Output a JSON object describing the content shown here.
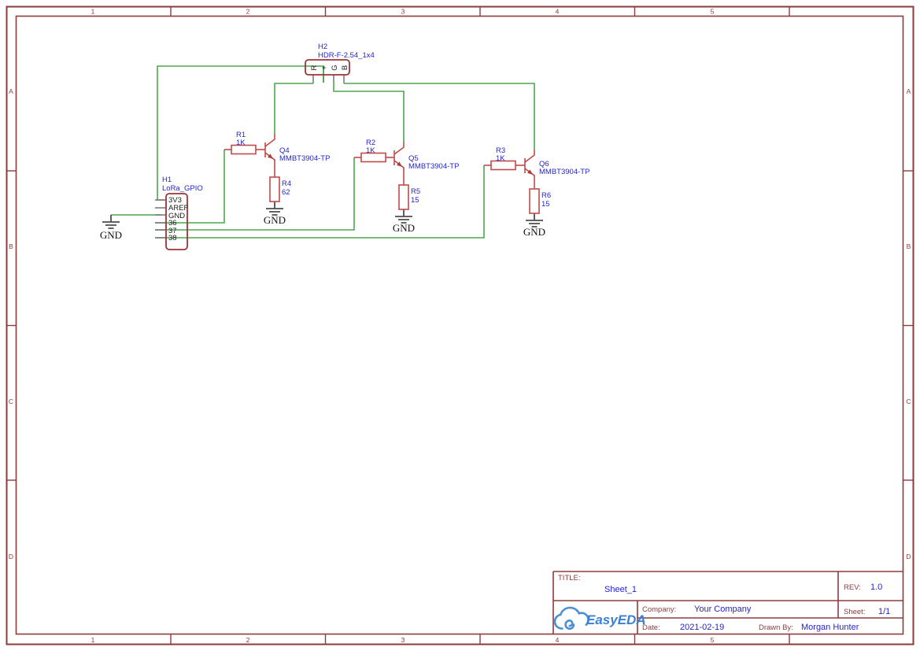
{
  "sheet": {
    "cols": [
      "1",
      "2",
      "3",
      "4",
      "5"
    ],
    "rows": [
      "A",
      "B",
      "C",
      "D"
    ]
  },
  "title_block": {
    "title_label": "TITLE:",
    "title": "Sheet_1",
    "rev_label": "REV:",
    "rev": "1.0",
    "company_label": "Company:",
    "company": "Your Company",
    "sheet_label": "Sheet:",
    "sheet": "1/1",
    "date_label": "Date:",
    "date": "2021-02-19",
    "drawn_by_label": "Drawn By:",
    "drawn_by": "Morgan Hunter",
    "logo_text": "EasyEDA"
  },
  "components": {
    "h2": {
      "ref": "H2",
      "value": "HDR-F-2.54_1x4",
      "pins": [
        "R",
        "+",
        "G",
        "B"
      ]
    },
    "h1": {
      "ref": "H1",
      "value": "LoRa_GPIO",
      "pins": [
        "3V3",
        "AREF",
        "GND",
        "36",
        "37",
        "38"
      ]
    },
    "r1": {
      "ref": "R1",
      "value": "1K"
    },
    "r2": {
      "ref": "R2",
      "value": "1K"
    },
    "r3": {
      "ref": "R3",
      "value": "1K"
    },
    "r4": {
      "ref": "R4",
      "value": "62"
    },
    "r5": {
      "ref": "R5",
      "value": "15"
    },
    "r6": {
      "ref": "R6",
      "value": "15"
    },
    "q4": {
      "ref": "Q4",
      "value": "MMBT3904-TP"
    },
    "q5": {
      "ref": "Q5",
      "value": "MMBT3904-TP"
    },
    "q6": {
      "ref": "Q6",
      "value": "MMBT3904-TP"
    }
  },
  "net_labels": {
    "gnd": "GND"
  },
  "colors": {
    "frame": "#8d3b3b",
    "wire_green": "#4aa64e",
    "component_red": "#bf4a47",
    "connector_box_red": "#9a3537",
    "annotation_blue": "#2424cd",
    "pin_text_black": "#1a1a1a",
    "pin_stub_gray": "#7b7b7b",
    "logo_blue": "#3f83d6",
    "background": "#ffffff"
  }
}
